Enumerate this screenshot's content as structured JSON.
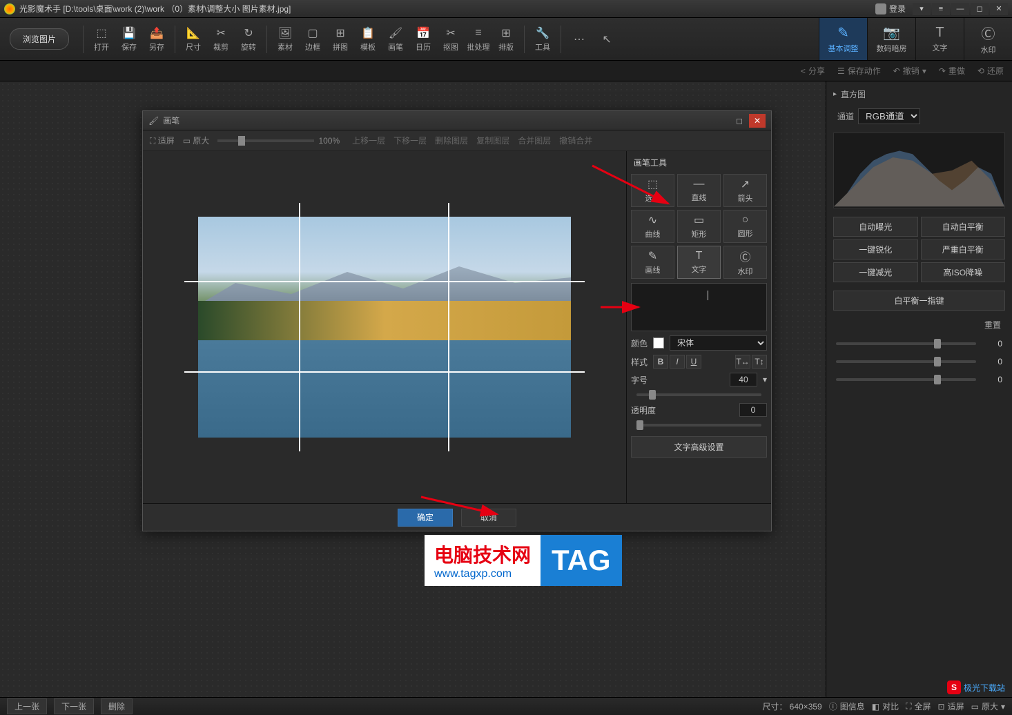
{
  "title": "光影魔术手   [D:\\tools\\桌面\\work (2)\\work （0）素材\\调整大小 图片素材.jpg]",
  "login": "登录",
  "browse": "浏览图片",
  "toolbar": [
    {
      "label": "打开"
    },
    {
      "label": "保存"
    },
    {
      "label": "另存"
    },
    {
      "label": "尺寸"
    },
    {
      "label": "裁剪"
    },
    {
      "label": "旋转"
    },
    {
      "label": "素材"
    },
    {
      "label": "边框"
    },
    {
      "label": "拼图"
    },
    {
      "label": "模板"
    },
    {
      "label": "画笔"
    },
    {
      "label": "日历"
    },
    {
      "label": "抠图"
    },
    {
      "label": "批处理"
    },
    {
      "label": "排版"
    },
    {
      "label": "工具"
    }
  ],
  "rtabs": [
    {
      "label": "基本调整",
      "active": true
    },
    {
      "label": "数码暗房"
    },
    {
      "label": "文字"
    },
    {
      "label": "水印"
    }
  ],
  "actionbar": {
    "share": "分享",
    "save_action": "保存动作",
    "undo": "撤销",
    "redo": "重做",
    "restore": "还原"
  },
  "panel": {
    "histogram": "直方图",
    "channel_label": "通道",
    "channel_value": "RGB通道",
    "buttons": [
      "自动曝光",
      "自动白平衡",
      "一键锐化",
      "严重白平衡",
      "一键减光",
      "高ISO降噪"
    ],
    "wb_onekey": "白平衡一指键",
    "reset": "重置",
    "slider_val": "0"
  },
  "dialog": {
    "title": "画笔",
    "fit": "适屏",
    "orig": "原大",
    "zoom": "100%",
    "layer_ops": [
      "上移一层",
      "下移一层",
      "删除图层",
      "复制图层",
      "合并图层",
      "撤销合并"
    ],
    "side_title": "画笔工具",
    "tools": [
      "选择",
      "直线",
      "箭头",
      "曲线",
      "矩形",
      "圆形",
      "画线",
      "文字",
      "水印"
    ],
    "color_label": "颜色",
    "font": "宋体",
    "style_label": "样式",
    "size_label": "字号",
    "size_val": "40",
    "opacity_label": "透明度",
    "opacity_val": "0",
    "advanced": "文字高级设置",
    "ok": "确定",
    "cancel": "取消"
  },
  "status": {
    "prev": "上一张",
    "next": "下一张",
    "delete": "删除",
    "size": "尺寸： 640×359",
    "info": "图信息",
    "compare": "对比",
    "fullscreen": "全屏",
    "fit": "适屏",
    "orig": "原大"
  },
  "watermark": {
    "l1": "电脑技术网",
    "l2": "www.tagxp.com",
    "tag": "TAG"
  }
}
